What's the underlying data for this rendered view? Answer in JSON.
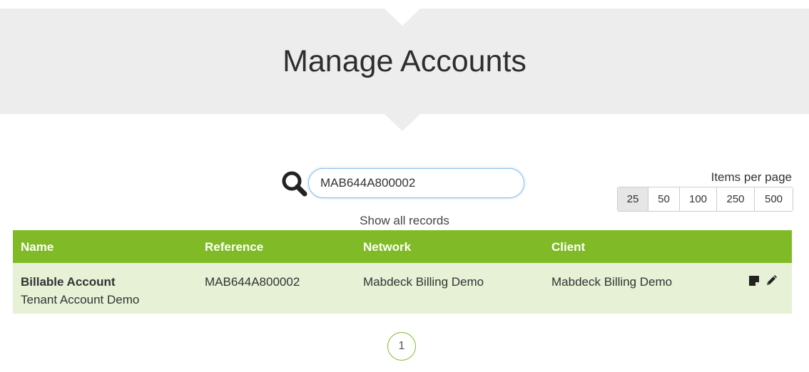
{
  "header": {
    "title": "Manage Accounts"
  },
  "search": {
    "value": "MAB644A800002",
    "show_all_label": "Show all records"
  },
  "items_per_page": {
    "label": "Items per page",
    "options": [
      "25",
      "50",
      "100",
      "250",
      "500"
    ],
    "selected": "25"
  },
  "table": {
    "columns": [
      "Name",
      "Reference",
      "Network",
      "Client"
    ],
    "rows": [
      {
        "name": "Billable Account",
        "subname": "Tenant Account Demo",
        "reference": "MAB644A800002",
        "network": "Mabdeck Billing Demo",
        "client": "Mabdeck Billing Demo",
        "actions": [
          "note-icon",
          "pencil-icon"
        ]
      }
    ]
  },
  "pagination": {
    "current_page": "1"
  },
  "colors": {
    "accent": "#80bb27",
    "row_bg": "#e6f1d6",
    "banner_bg": "#ededed"
  }
}
